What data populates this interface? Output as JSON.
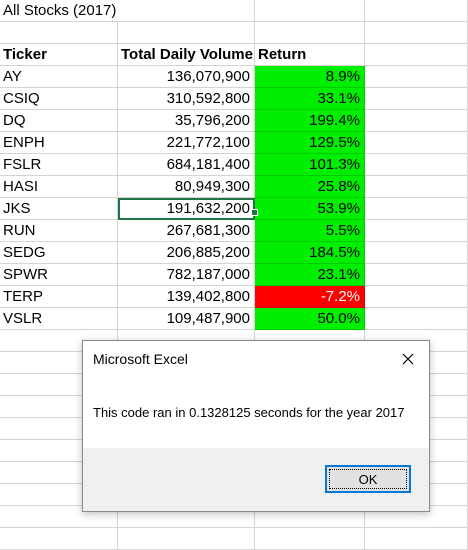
{
  "sheet": {
    "title": "All Stocks (2017)",
    "headers": {
      "ticker": "Ticker",
      "volume": "Total Daily Volume",
      "return": "Return"
    },
    "rows": [
      {
        "ticker": "AY",
        "volume": "136,070,900",
        "return": "8.9%",
        "status": "positive"
      },
      {
        "ticker": "CSIQ",
        "volume": "310,592,800",
        "return": "33.1%",
        "status": "positive"
      },
      {
        "ticker": "DQ",
        "volume": "35,796,200",
        "return": "199.4%",
        "status": "positive"
      },
      {
        "ticker": "ENPH",
        "volume": "221,772,100",
        "return": "129.5%",
        "status": "positive"
      },
      {
        "ticker": "FSLR",
        "volume": "684,181,400",
        "return": "101.3%",
        "status": "positive"
      },
      {
        "ticker": "HASI",
        "volume": "80,949,300",
        "return": "25.8%",
        "status": "positive"
      },
      {
        "ticker": "JKS",
        "volume": "191,632,200",
        "return": "53.9%",
        "status": "positive"
      },
      {
        "ticker": "RUN",
        "volume": "267,681,300",
        "return": "5.5%",
        "status": "positive"
      },
      {
        "ticker": "SEDG",
        "volume": "206,885,200",
        "return": "184.5%",
        "status": "positive"
      },
      {
        "ticker": "SPWR",
        "volume": "782,187,000",
        "return": "23.1%",
        "status": "positive"
      },
      {
        "ticker": "TERP",
        "volume": "139,402,800",
        "return": "-7.2%",
        "status": "negative"
      },
      {
        "ticker": "VSLR",
        "volume": "109,487,900",
        "return": "50.0%",
        "status": "positive"
      }
    ],
    "colors": {
      "positive": "#00ee00",
      "negative": "#ff0000",
      "selection": "#217346"
    }
  },
  "dialog": {
    "title": "Microsoft Excel",
    "message": "This code ran in 0.1328125 seconds for the year 2017",
    "ok_label": "OK",
    "close_icon": "close-icon"
  }
}
